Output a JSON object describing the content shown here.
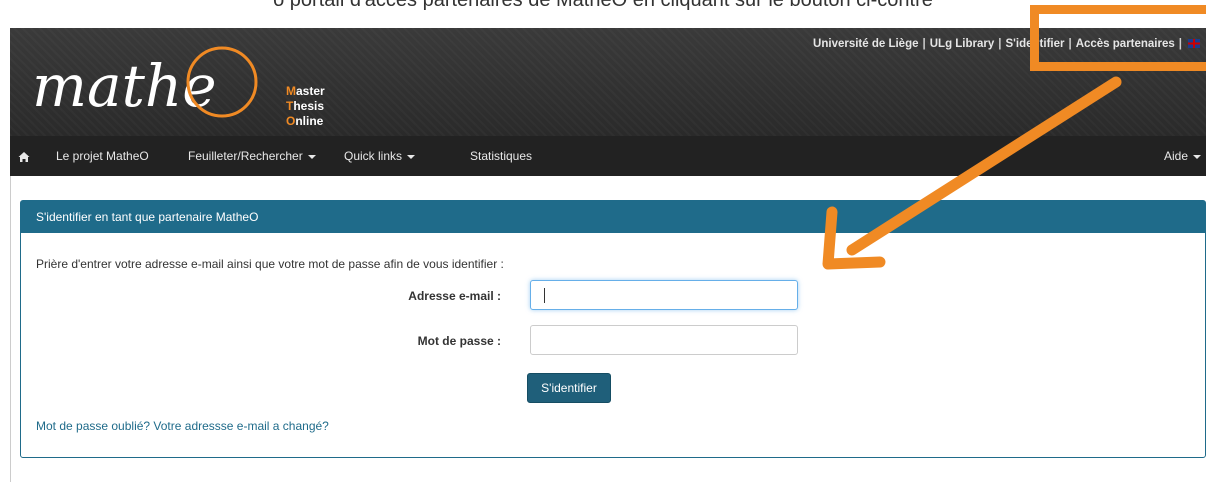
{
  "top_strip": {
    "text": "o portail d'accès partenaires de MatheO en cliquant sur le bouton ci-contre"
  },
  "brand": {
    "logo_text": "mathe",
    "lines": [
      {
        "first": "M",
        "rest": "aster"
      },
      {
        "first": "T",
        "rest": "hesis"
      },
      {
        "first": "O",
        "rest": "nline"
      }
    ]
  },
  "toplinks": {
    "items": [
      "Université de Liège",
      "ULg Library",
      "S'identifier",
      "Accès partenaires"
    ]
  },
  "nav": {
    "home_icon": "home-icon",
    "items": [
      {
        "label": "Le projet MatheO"
      },
      {
        "label": "Feuilleter/Rechercher"
      },
      {
        "label": "Quick links"
      },
      {
        "label": "Statistiques"
      }
    ],
    "help": "Aide"
  },
  "panel": {
    "title": "S'identifier en tant que partenaire MatheO",
    "intro": "Prière d'entrer votre adresse e-mail ainsi que votre mot de passe afin de vous identifier :",
    "email_label": "Adresse e-mail :",
    "email_value": "",
    "password_label": "Mot de passe :",
    "password_value": "",
    "submit": "S'identifier",
    "forgot": "Mot de passe oublié? Votre adressse e-mail a changé?"
  },
  "colors": {
    "annotation": "#f08a24",
    "panel_header": "#1f6b8a",
    "navbar": "#222222"
  }
}
